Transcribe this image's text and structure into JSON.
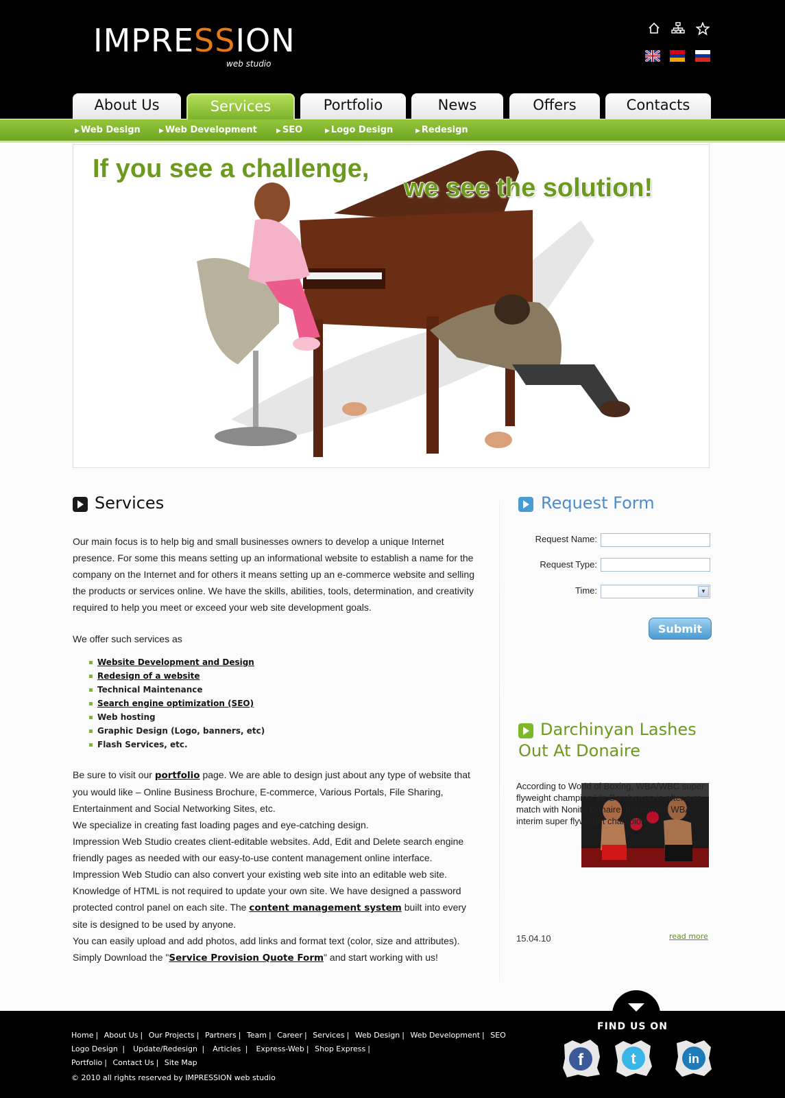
{
  "brand": {
    "logo_prefix": "IMPRE",
    "logo_ss": "SS",
    "logo_suffix": "ION",
    "logo_sub": "web studio"
  },
  "header_icons": [
    "home-icon",
    "sitemap-icon",
    "star-icon"
  ],
  "languages": [
    "english-flag",
    "armenian-flag",
    "russian-flag"
  ],
  "nav": {
    "tabs": [
      "About Us",
      "Services",
      "Portfolio",
      "News",
      "Offers",
      "Contacts"
    ],
    "active": "Services"
  },
  "subnav": [
    "Web Design",
    "Web Development",
    "SEO",
    "Logo Design",
    "Redesign"
  ],
  "banner": {
    "line1": "If you see a challenge,",
    "line2": "we see the solution!"
  },
  "services": {
    "title": "Services",
    "intro": "Our main focus is to help big and small businesses owners to develop a unique Internet presence. For some this means setting up an informational website to establish a name for the company on the Internet and for others it means setting up an e-commerce website and selling the products or services online. We have the skills, abilities, tools, determination, and creativity required to help you meet or exceed your web site development goals.",
    "offer_lead": "We  offer such services as",
    "list": [
      "Website Development and Design",
      "Redesign of   a  website",
      "Technical Maintenance",
      "Search engine optimization (SEO)",
      "Web hosting",
      "Graphic Design (Logo, banners, etc)",
      "Flash Services, etc."
    ],
    "p2_a": "Be sure  to visit our ",
    "p2_link": "portfolio",
    "p2_b": " page. We are able to design just about any type of website that you would like – Online Business Brochure, E-commerce, Various  Portals, File Sharing, Entertainment  and Social Networking Sites, etc.",
    "p3": "We specialize in creating  fast loading pages and eye-catching design.",
    "p4": " Impression Web Studio creates client-editable websites. Add, Edit and Delete search engine friendly pages as needed with our easy-to-use content management online interface.",
    "p5": "Impression Web Studio can also convert your existing web site into an editable web site.",
    "p6_a": "Knowledge of HTML is not required to update your own site. We have designed a password protected control panel on each site. The ",
    "p6_link": "content management system",
    "p6_b": " built into every site is designed to be used by anyone.",
    "p7": "You can easily upload and add  photos, add links and format text (color, size and attributes).",
    "p8_a": "Simply Download the \"",
    "p8_link": "Service Provision Quote Form",
    "p8_b": "\" and start working with us!"
  },
  "request_form": {
    "title": "Request Form",
    "name_label": "Request Name:",
    "type_label": "Request Type:",
    "time_label": "Time:",
    "name_value": "",
    "type_value": "",
    "time_value": "",
    "submit": "Submit"
  },
  "news": {
    "title": "Darchinyan Lashes Out At Donaire",
    "text": "According to World of Boxing, WBA/WBC super flyweight champion Vic Darchinyan is after a re-match with Nonito Donaire, the current WBA interim super flyweight champion.",
    "date": "15.04.10",
    "read_more": "read more"
  },
  "footer": {
    "row1": [
      "Home",
      "About Us",
      "Our Projects",
      "Partners",
      "Team",
      "Career",
      "Services",
      "Web Design",
      "Web Development",
      "SEO"
    ],
    "row2": [
      "Logo Design",
      "Update/Redesign",
      "Articles",
      "Express-Web",
      "Shop Express"
    ],
    "row3": [
      "Portfolio",
      "Contact Us",
      "Site Map"
    ],
    "copyright": "© 2010 all rights reserved by IMPRESSION web studio",
    "find_us": "FIND US ON",
    "social": [
      "facebook-icon",
      "twitter-icon",
      "linkedin-icon"
    ]
  },
  "colors": {
    "accent_green": "#6c9a1f",
    "nav_green": "#7bb32a",
    "form_blue": "#4a8ccb",
    "header_bg": "#000000"
  }
}
